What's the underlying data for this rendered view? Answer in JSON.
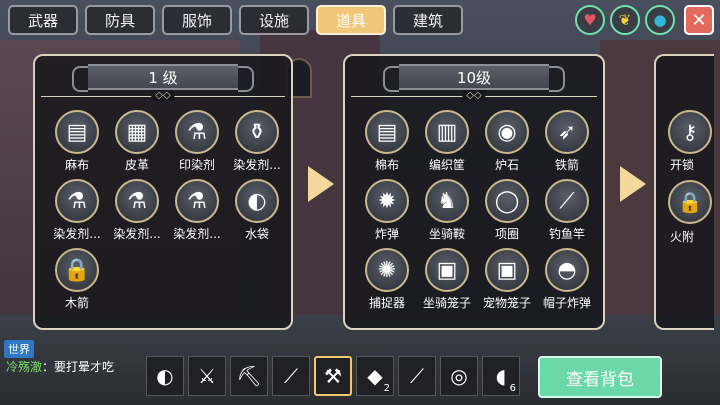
{
  "tabs": [
    {
      "label": "武器",
      "active": false
    },
    {
      "label": "防具",
      "active": false
    },
    {
      "label": "服饰",
      "active": false
    },
    {
      "label": "设施",
      "active": false
    },
    {
      "label": "道具",
      "active": true
    },
    {
      "label": "建筑",
      "active": false
    }
  ],
  "top_icons": {
    "heart": "heart-icon",
    "leaf": "leaf-icon",
    "drop": "water-drop-icon",
    "close": "✕"
  },
  "panels": [
    {
      "title": "1  级",
      "items": [
        {
          "label": "麻布",
          "icon": "cloth-icon",
          "glyph": "▤"
        },
        {
          "label": "皮革",
          "icon": "leather-icon",
          "glyph": "▦"
        },
        {
          "label": "印染剂",
          "icon": "dye-flask-icon",
          "glyph": "⚗"
        },
        {
          "label": "染发剂...",
          "icon": "hair-dye-icon",
          "glyph": "⚱"
        },
        {
          "label": "染发剂...",
          "icon": "hair-dye-icon",
          "glyph": "⚗"
        },
        {
          "label": "染发剂...",
          "icon": "hair-dye-icon",
          "glyph": "⚗"
        },
        {
          "label": "染发剂...",
          "icon": "hair-dye-icon",
          "glyph": "⚗"
        },
        {
          "label": "水袋",
          "icon": "water-bag-icon",
          "glyph": "◐"
        },
        {
          "label": "木箭",
          "icon": "lock-icon",
          "glyph": "🔒"
        }
      ]
    },
    {
      "title": "10级",
      "items": [
        {
          "label": "棉布",
          "icon": "cotton-cloth-icon",
          "glyph": "▤"
        },
        {
          "label": "编织筐",
          "icon": "basket-icon",
          "glyph": "▥"
        },
        {
          "label": "炉石",
          "icon": "hearthstone-icon",
          "glyph": "◉"
        },
        {
          "label": "铁箭",
          "icon": "iron-arrow-icon",
          "glyph": "➶"
        },
        {
          "label": "炸弹",
          "icon": "bomb-icon",
          "glyph": "✹"
        },
        {
          "label": "坐骑鞍",
          "icon": "saddle-icon",
          "glyph": "♞"
        },
        {
          "label": "项圈",
          "icon": "collar-icon",
          "glyph": "◯"
        },
        {
          "label": "钓鱼竿",
          "icon": "fishing-rod-icon",
          "glyph": "⟋"
        },
        {
          "label": "捕捉器",
          "icon": "trap-icon",
          "glyph": "✺"
        },
        {
          "label": "坐骑笼子",
          "icon": "mount-cage-icon",
          "glyph": "▣"
        },
        {
          "label": "宠物笼子",
          "icon": "pet-cage-icon",
          "glyph": "▣"
        },
        {
          "label": "帽子炸弹",
          "icon": "hat-bomb-icon",
          "glyph": "◓"
        }
      ]
    }
  ],
  "partial_panel": {
    "items": [
      {
        "label": "开锁",
        "icon": "lockpick-icon",
        "glyph": "⚷"
      },
      {
        "label": "火附",
        "icon": "fire-charm-icon",
        "glyph": "🔒"
      }
    ]
  },
  "chat": {
    "channel": "世界",
    "name": "冷殇澈",
    "message": "：要打晕才吃"
  },
  "hotbar": [
    {
      "icon": "water-bag-icon",
      "glyph": "◐",
      "count": ""
    },
    {
      "icon": "sword-icon",
      "glyph": "⚔",
      "count": ""
    },
    {
      "icon": "pickaxe-icon",
      "glyph": "⛏",
      "count": ""
    },
    {
      "icon": "club-icon",
      "glyph": "⟋",
      "count": ""
    },
    {
      "icon": "axe-icon",
      "glyph": "⚒",
      "count": "",
      "selected": true
    },
    {
      "icon": "meat-icon",
      "glyph": "◆",
      "count": "2"
    },
    {
      "icon": "staff-icon",
      "glyph": "⟋",
      "count": ""
    },
    {
      "icon": "disc-icon",
      "glyph": "◎",
      "count": ""
    },
    {
      "icon": "drumstick-icon",
      "glyph": "◖",
      "count": "6"
    }
  ],
  "bag_button": "查看背包"
}
